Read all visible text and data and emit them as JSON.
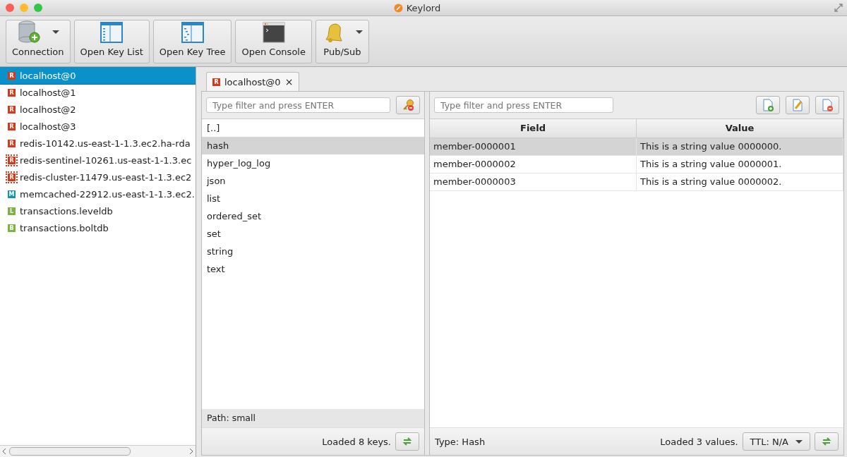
{
  "window": {
    "title": "Keylord"
  },
  "toolbar": [
    {
      "label": "Connection",
      "kind": "database",
      "dropdown": true
    },
    {
      "label": "Open Key List",
      "kind": "list",
      "dropdown": false
    },
    {
      "label": "Open Key Tree",
      "kind": "tree",
      "dropdown": false
    },
    {
      "label": "Open Console",
      "kind": "console",
      "dropdown": false
    },
    {
      "label": "Pub/Sub",
      "kind": "bell",
      "dropdown": true
    }
  ],
  "connections": [
    {
      "name": "localhost@0",
      "kind": "redis",
      "badge": "R",
      "selected": true
    },
    {
      "name": "localhost@1",
      "kind": "redis",
      "badge": "R",
      "selected": false
    },
    {
      "name": "localhost@2",
      "kind": "redis",
      "badge": "R",
      "selected": false
    },
    {
      "name": "localhost@3",
      "kind": "redis",
      "badge": "R",
      "selected": false
    },
    {
      "name": "redis-10142.us-east-1-1.3.ec2.ha-rda",
      "kind": "redis",
      "badge": "R",
      "selected": false
    },
    {
      "name": "redis-sentinel-10261.us-east-1-1.3.ec",
      "kind": "sentinel",
      "badge": "R",
      "selected": false
    },
    {
      "name": "redis-cluster-11479.us-east-1-1.3.ec2",
      "kind": "cluster",
      "badge": "R",
      "selected": false
    },
    {
      "name": "memcached-22912.us-east-1-1.3.ec2.",
      "kind": "memcached",
      "badge": "M",
      "selected": false
    },
    {
      "name": "transactions.leveldb",
      "kind": "leveldb",
      "badge": "L",
      "selected": false
    },
    {
      "name": "transactions.boltdb",
      "kind": "boltdb",
      "badge": "B",
      "selected": false
    }
  ],
  "tab": {
    "label": "localhost@0",
    "badge": "R",
    "close": "×"
  },
  "keys": {
    "placeholder": "Type filter and press ENTER",
    "items": [
      {
        "name": "[..]",
        "selected": false
      },
      {
        "name": "hash",
        "selected": true
      },
      {
        "name": "hyper_log_log",
        "selected": false
      },
      {
        "name": "json",
        "selected": false
      },
      {
        "name": "list",
        "selected": false
      },
      {
        "name": "ordered_set",
        "selected": false
      },
      {
        "name": "set",
        "selected": false
      },
      {
        "name": "string",
        "selected": false
      },
      {
        "name": "text",
        "selected": false
      }
    ],
    "path": "Path: small",
    "status": "Loaded 8 keys."
  },
  "values": {
    "placeholder": "Type filter and press ENTER",
    "columns": [
      "Field",
      "Value"
    ],
    "rows": [
      {
        "cells": [
          "member-0000001",
          "This is a string value 0000000."
        ],
        "selected": true
      },
      {
        "cells": [
          "member-0000002",
          "This is a string value 0000001."
        ],
        "selected": false
      },
      {
        "cells": [
          "member-0000003",
          "This is a string value 0000002."
        ],
        "selected": false
      }
    ],
    "type": "Type: Hash",
    "status": "Loaded 3 values.",
    "ttl": "TTL: N/A"
  }
}
